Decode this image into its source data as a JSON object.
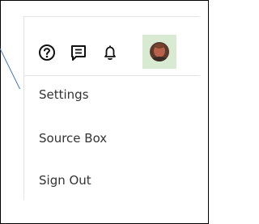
{
  "toolbar": {
    "icons": [
      "help-circle-icon",
      "message-icon",
      "bell-icon",
      "user-avatar"
    ],
    "avatar_bg": "#d9ead3"
  },
  "menu": {
    "items": [
      {
        "label": "Settings"
      },
      {
        "label": "Source Box"
      },
      {
        "label": "Sign Out"
      }
    ]
  },
  "annotation": {
    "arrow_color": "#4472c4"
  }
}
